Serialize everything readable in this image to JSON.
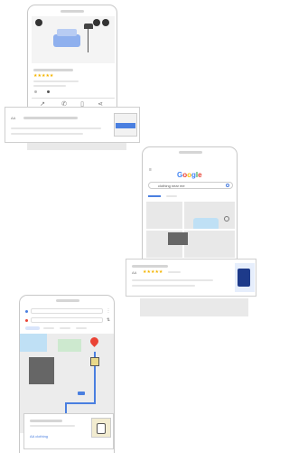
{
  "scene1": {
    "card_label": "AA"
  },
  "scene2": {
    "logo_letters": [
      {
        "ch": "G",
        "color": "#4285f4"
      },
      {
        "ch": "o",
        "color": "#ea4335"
      },
      {
        "ch": "o",
        "color": "#fbbc05"
      },
      {
        "ch": "g",
        "color": "#4285f4"
      },
      {
        "ch": "l",
        "color": "#34a853"
      },
      {
        "ch": "e",
        "color": "#ea4335"
      }
    ],
    "search_query": "clothing near me",
    "result_label": "AA",
    "rating_stars": "★★★★★"
  },
  "scene3": {
    "bottom_label": "AA clothing"
  },
  "colors": {
    "accent_blue": "#4a7fe0",
    "star_yellow": "#f4b400",
    "pin_red": "#ea4335",
    "park_green": "#cde9cf",
    "water_blue": "#bfe0f5"
  }
}
